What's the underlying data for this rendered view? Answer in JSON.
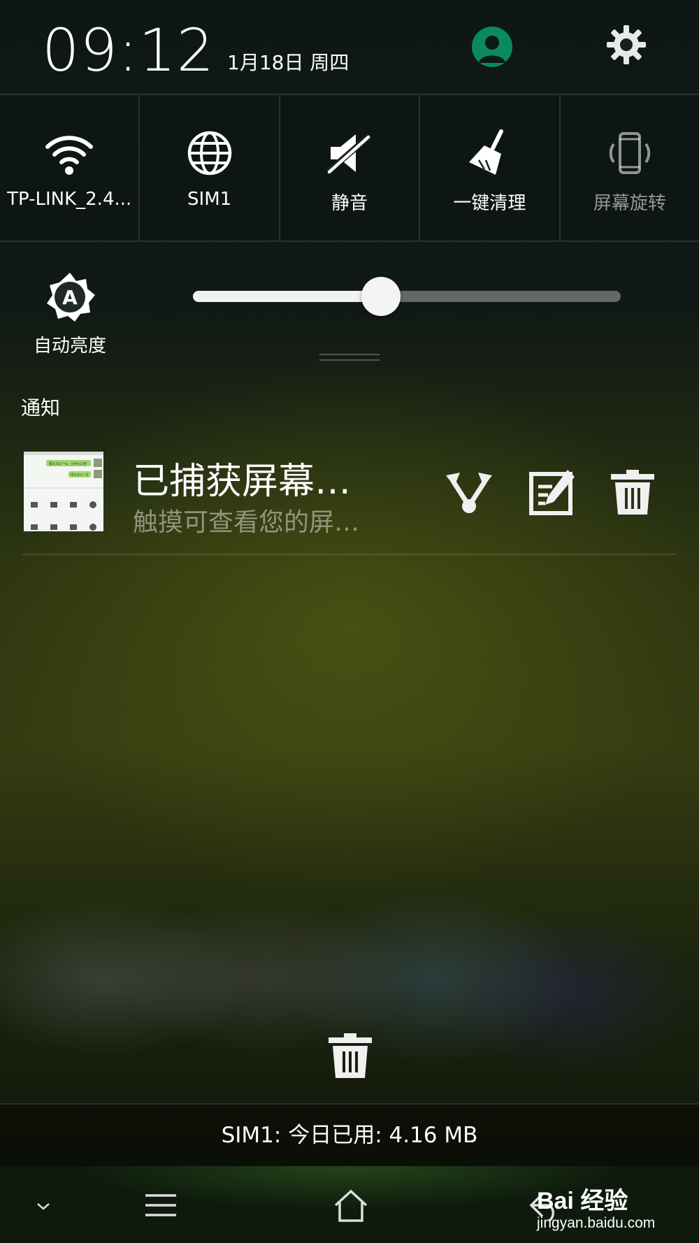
{
  "status": {
    "time": "09:12",
    "date": "1月18日 周四"
  },
  "quick_settings": [
    {
      "label": "TP-LINK_2.4...",
      "icon": "wifi-icon"
    },
    {
      "label": "SIM1",
      "icon": "globe-icon"
    },
    {
      "label": "静音",
      "icon": "mute-icon"
    },
    {
      "label": "一键清理",
      "icon": "broom-icon"
    },
    {
      "label": "屏幕旋转",
      "icon": "rotate-icon"
    }
  ],
  "brightness": {
    "auto_label": "自动亮度",
    "level": 0.44
  },
  "notifications": {
    "header": "通知",
    "items": [
      {
        "title": "已捕获屏幕…",
        "subtitle": "触摸可查看您的屏…",
        "actions": [
          "share-icon",
          "edit-icon",
          "delete-icon"
        ],
        "thumbnail_bubbles": [
          "看3.5公一v。小4七口也",
          "半3.5+一2"
        ]
      }
    ]
  },
  "data_usage": "SIM1: 今日已用: 4.16 MB",
  "navbar": [
    "down-chevron-icon",
    "menu-icon",
    "home-icon",
    "back-icon"
  ],
  "watermark": {
    "brand": "Bai 经验",
    "url": "jingyan.baidu.com"
  },
  "colors": {
    "avatar_bg": "#0a8a5d",
    "thumbnail_bubble": "#9bd86a"
  }
}
